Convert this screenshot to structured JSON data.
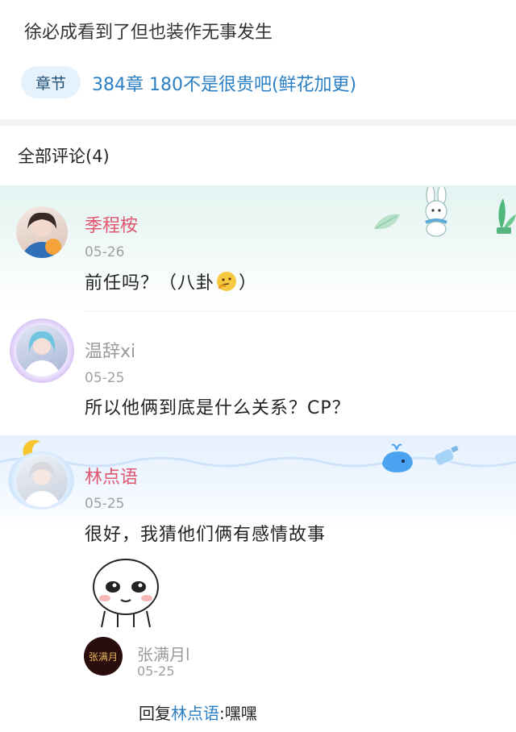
{
  "book": {
    "intro_text": "徐必成看到了但也装作无事发生",
    "chapter_tag": "章节",
    "chapter_title": "384章 180不是很贵吧(鲜花加更)"
  },
  "comments_header": "全部评论(4)",
  "comments": [
    {
      "user": "季程桉",
      "date": "05-26",
      "text_before_emoji": "前任吗？（八卦",
      "text_after_emoji": "）",
      "name_color": "#e0566e"
    },
    {
      "user": "温辞xi",
      "date": "05-25",
      "text": "所以他俩到底是什么关系？CP？",
      "name_color": "#9a9a9a"
    },
    {
      "user": "林点语",
      "date": "05-25",
      "text": "很好，我猜他们俩有感情故事",
      "name_color": "#e0566e",
      "reply": {
        "user": "张满月l",
        "date": "05-25",
        "prefix": "回复",
        "target": "林点语",
        "separator": ":",
        "text": "嘿嘿",
        "avatar_text": "张满月"
      }
    }
  ]
}
